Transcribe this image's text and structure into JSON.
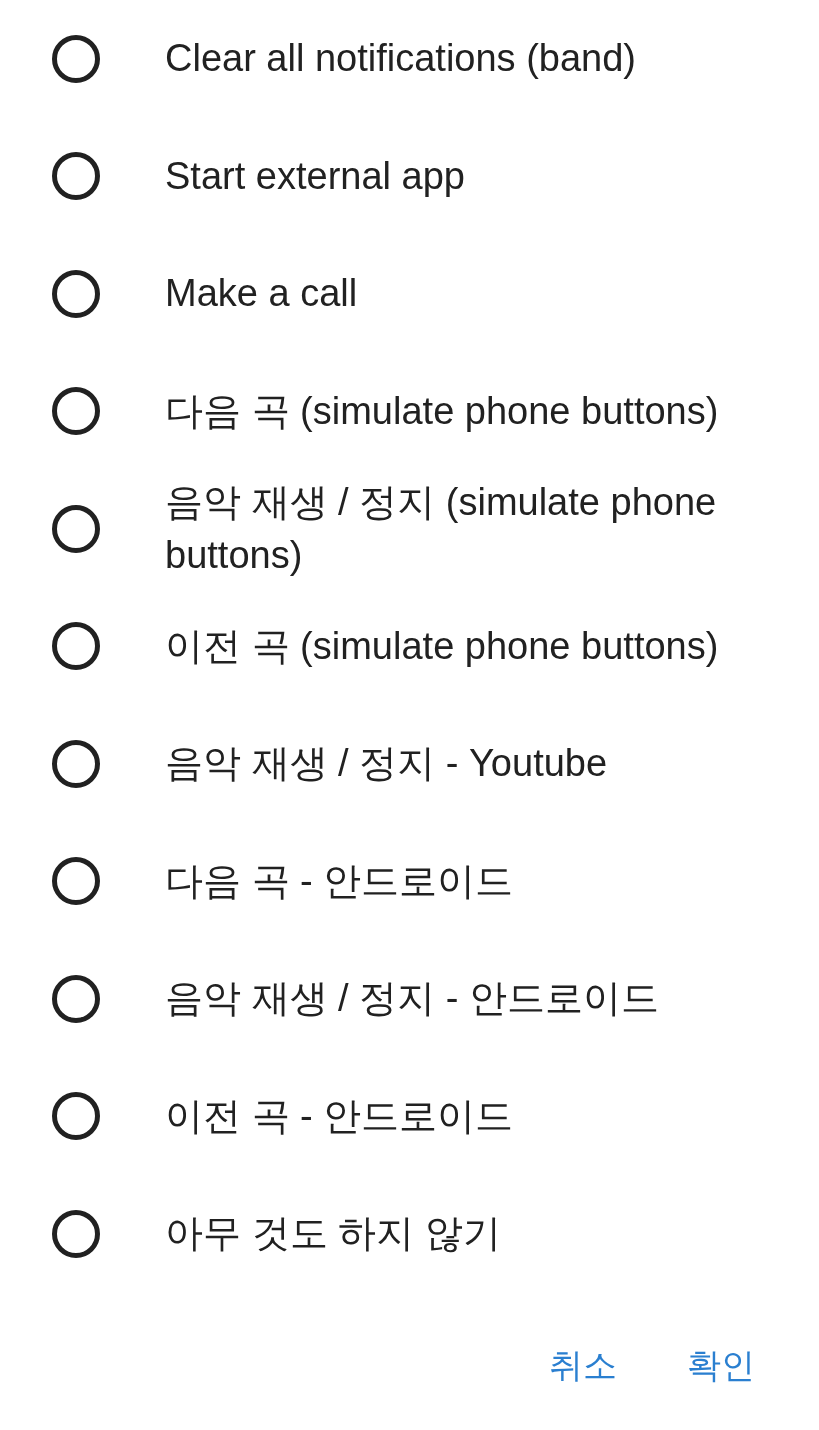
{
  "options": [
    {
      "label": "Clear all notifications (band)",
      "selected": false
    },
    {
      "label": "Start external app",
      "selected": false
    },
    {
      "label": "Make a call",
      "selected": false
    },
    {
      "label": "다음 곡 (simulate phone buttons)",
      "selected": false
    },
    {
      "label": "음악 재생 / 정지 (simulate phone buttons)",
      "selected": false
    },
    {
      "label": "이전 곡 (simulate phone buttons)",
      "selected": false
    },
    {
      "label": "음악 재생 / 정지 - Youtube",
      "selected": false
    },
    {
      "label": "다음 곡 - 안드로이드",
      "selected": false
    },
    {
      "label": "음악 재생 / 정지 - 안드로이드",
      "selected": false
    },
    {
      "label": "이전 곡 - 안드로이드",
      "selected": false
    },
    {
      "label": "아무 것도 하지 않기",
      "selected": false
    }
  ],
  "buttons": [
    "취소",
    "확인"
  ]
}
